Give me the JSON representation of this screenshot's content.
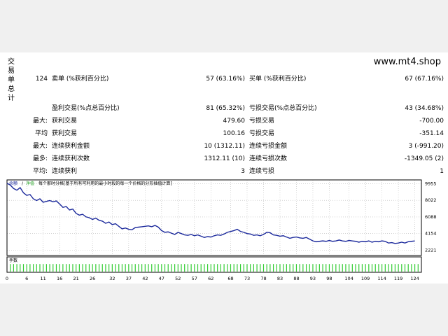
{
  "watermark": "www.mt4.shop",
  "side_label": [
    "交",
    "易",
    "单",
    "总",
    "计"
  ],
  "stats": {
    "total_trades": "124",
    "short_label": "卖单 (%获利百分比)",
    "short_value": "57 (63.16%)",
    "long_label": "买单 (%获利百分比)",
    "long_value": "67 (67.16%)",
    "profit_trades_label": "盈利交易(%点总百分比)",
    "profit_trades_value": "81 (65.32%)",
    "loss_trades_label": "亏损交易(%点总百分比)",
    "loss_trades_value": "43 (34.68%)",
    "largest_prefix": "最大:",
    "largest_profit_label": "获利交易",
    "largest_profit_value": "479.60",
    "largest_loss_label": "亏损交易",
    "largest_loss_value": "-700.00",
    "average_prefix": "平均",
    "average_profit_label": "获利交易",
    "average_profit_value": "100.16",
    "average_loss_label": "亏损交易",
    "average_loss_value": "-351.14",
    "max_consec_prefix": "最大:",
    "max_consec_wins_label": "连续获利金额",
    "max_consec_wins_value": "10 (1312.11)",
    "max_consec_losses_label": "连续亏损金额",
    "max_consec_losses_value": "3 (-991.20)",
    "max_amount_prefix": "最多:",
    "max_consec_profit_label": "连续获利次数",
    "max_consec_profit_value": "1312.11 (10)",
    "max_consec_loss_label": "连续亏损次数",
    "max_consec_loss_value": "-1349.05 (2)",
    "avg_consec_prefix": "平均:",
    "avg_consec_wins_label": "连续获利",
    "avg_consec_wins_value": "3",
    "avg_consec_losses_label": "连续亏损",
    "avg_consec_losses_value": "1"
  },
  "chart_legend": {
    "balance": "余额",
    "separator": "/",
    "equity": "净值",
    "description": "每个那时分格[基于所有可利用的最小时段的每一个价格的分形插值计算]"
  },
  "volume_label": "手数",
  "colors": {
    "balance_line": "#1c2a9c",
    "volume_bar": "#33cc33",
    "grid": "#b8b8b8"
  },
  "chart_data": {
    "type": "line",
    "title": "",
    "y_ticks": [
      "9955",
      "8022",
      "6088",
      "4154",
      "2221"
    ],
    "y_tick_values": [
      9955,
      8022,
      6088,
      4154,
      2221
    ],
    "ylim": [
      1600,
      10400
    ],
    "x_ticks": [
      "0",
      "6",
      "11",
      "16",
      "21",
      "26",
      "32",
      "37",
      "42",
      "47",
      "52",
      "57",
      "62",
      "68",
      "73",
      "78",
      "83",
      "88",
      "93",
      "98",
      "104",
      "109",
      "114",
      "119",
      "124"
    ],
    "xlim": [
      0,
      126
    ],
    "series": [
      {
        "name": "余额",
        "x": [
          0,
          1,
          2,
          3,
          4,
          5,
          6,
          7,
          8,
          9,
          10,
          11,
          12,
          13,
          14,
          15,
          16,
          17,
          18,
          19,
          20,
          21,
          22,
          23,
          24,
          25,
          26,
          27,
          28,
          29,
          30,
          31,
          32,
          33,
          34,
          35,
          36,
          37,
          38,
          39,
          40,
          41,
          42,
          43,
          44,
          45,
          46,
          47,
          48,
          49,
          50,
          51,
          52,
          53,
          54,
          55,
          56,
          57,
          58,
          59,
          60,
          61,
          62,
          63,
          64,
          65,
          66,
          67,
          68,
          69,
          70,
          71,
          72,
          73,
          74,
          75,
          76,
          77,
          78,
          79,
          80,
          81,
          82,
          83,
          84,
          85,
          86,
          87,
          88,
          89,
          90,
          91,
          92,
          93,
          94,
          95,
          96,
          97,
          98,
          99,
          100,
          101,
          102,
          103,
          104,
          105,
          106,
          107,
          108,
          109,
          110,
          111,
          112,
          113,
          114,
          115,
          116,
          117,
          118,
          119,
          120,
          121,
          122,
          123,
          124
        ],
        "values": [
          10000,
          9800,
          9400,
          9200,
          9500,
          8900,
          8600,
          8700,
          8200,
          8000,
          8200,
          7800,
          7900,
          8000,
          7850,
          7950,
          7600,
          7200,
          7300,
          6900,
          7000,
          6500,
          6300,
          6400,
          6100,
          6000,
          5800,
          5950,
          5700,
          5600,
          5350,
          5500,
          5200,
          5300,
          5000,
          4700,
          4800,
          4650,
          4600,
          4850,
          4900,
          4950,
          5000,
          5050,
          4950,
          5100,
          4900,
          4500,
          4300,
          4350,
          4200,
          4050,
          4300,
          4150,
          4000,
          3950,
          4050,
          3900,
          4000,
          3850,
          3700,
          3800,
          3750,
          3900,
          4000,
          3950,
          4100,
          4300,
          4400,
          4500,
          4650,
          4400,
          4300,
          4150,
          4100,
          3950,
          4000,
          3900,
          4050,
          4300,
          4250,
          4000,
          3950,
          3850,
          3900,
          3750,
          3600,
          3700,
          3750,
          3650,
          3600,
          3700,
          3500,
          3300,
          3200,
          3250,
          3300,
          3250,
          3350,
          3250,
          3300,
          3400,
          3300,
          3250,
          3350,
          3300,
          3250,
          3150,
          3250,
          3200,
          3300,
          3150,
          3250,
          3200,
          3300,
          3250,
          3050,
          3100,
          3000,
          3050,
          3150,
          3050,
          3200,
          3250,
          3300
        ]
      }
    ],
    "volume": {
      "name": "手数",
      "values": [
        5,
        5,
        5,
        5,
        5,
        5,
        5,
        5,
        5,
        5,
        5,
        5,
        5,
        5,
        5,
        5,
        5,
        5,
        5,
        5,
        5,
        5,
        5,
        5,
        5,
        5,
        5,
        5,
        5,
        5,
        5,
        5,
        5,
        5,
        5,
        5,
        5,
        5,
        5,
        5,
        5,
        5,
        5,
        5,
        5,
        5,
        5,
        5,
        5,
        5,
        5,
        5,
        5,
        5,
        5,
        5,
        5,
        5,
        5,
        5,
        5,
        5,
        5,
        5,
        5,
        5,
        5,
        5,
        5,
        5,
        5,
        5,
        5,
        5,
        5,
        5,
        5,
        5,
        5,
        5,
        5,
        5,
        5,
        5,
        5,
        5,
        5,
        5,
        5,
        5,
        5,
        5,
        5,
        5,
        5,
        5,
        5,
        5,
        5,
        5,
        5,
        5,
        5,
        5,
        5,
        5,
        5,
        5,
        5,
        5,
        5,
        5,
        5,
        5,
        5,
        5,
        5,
        5,
        5,
        5,
        5,
        5,
        5,
        5,
        5
      ]
    },
    "grid": true,
    "legend": "top-left"
  }
}
